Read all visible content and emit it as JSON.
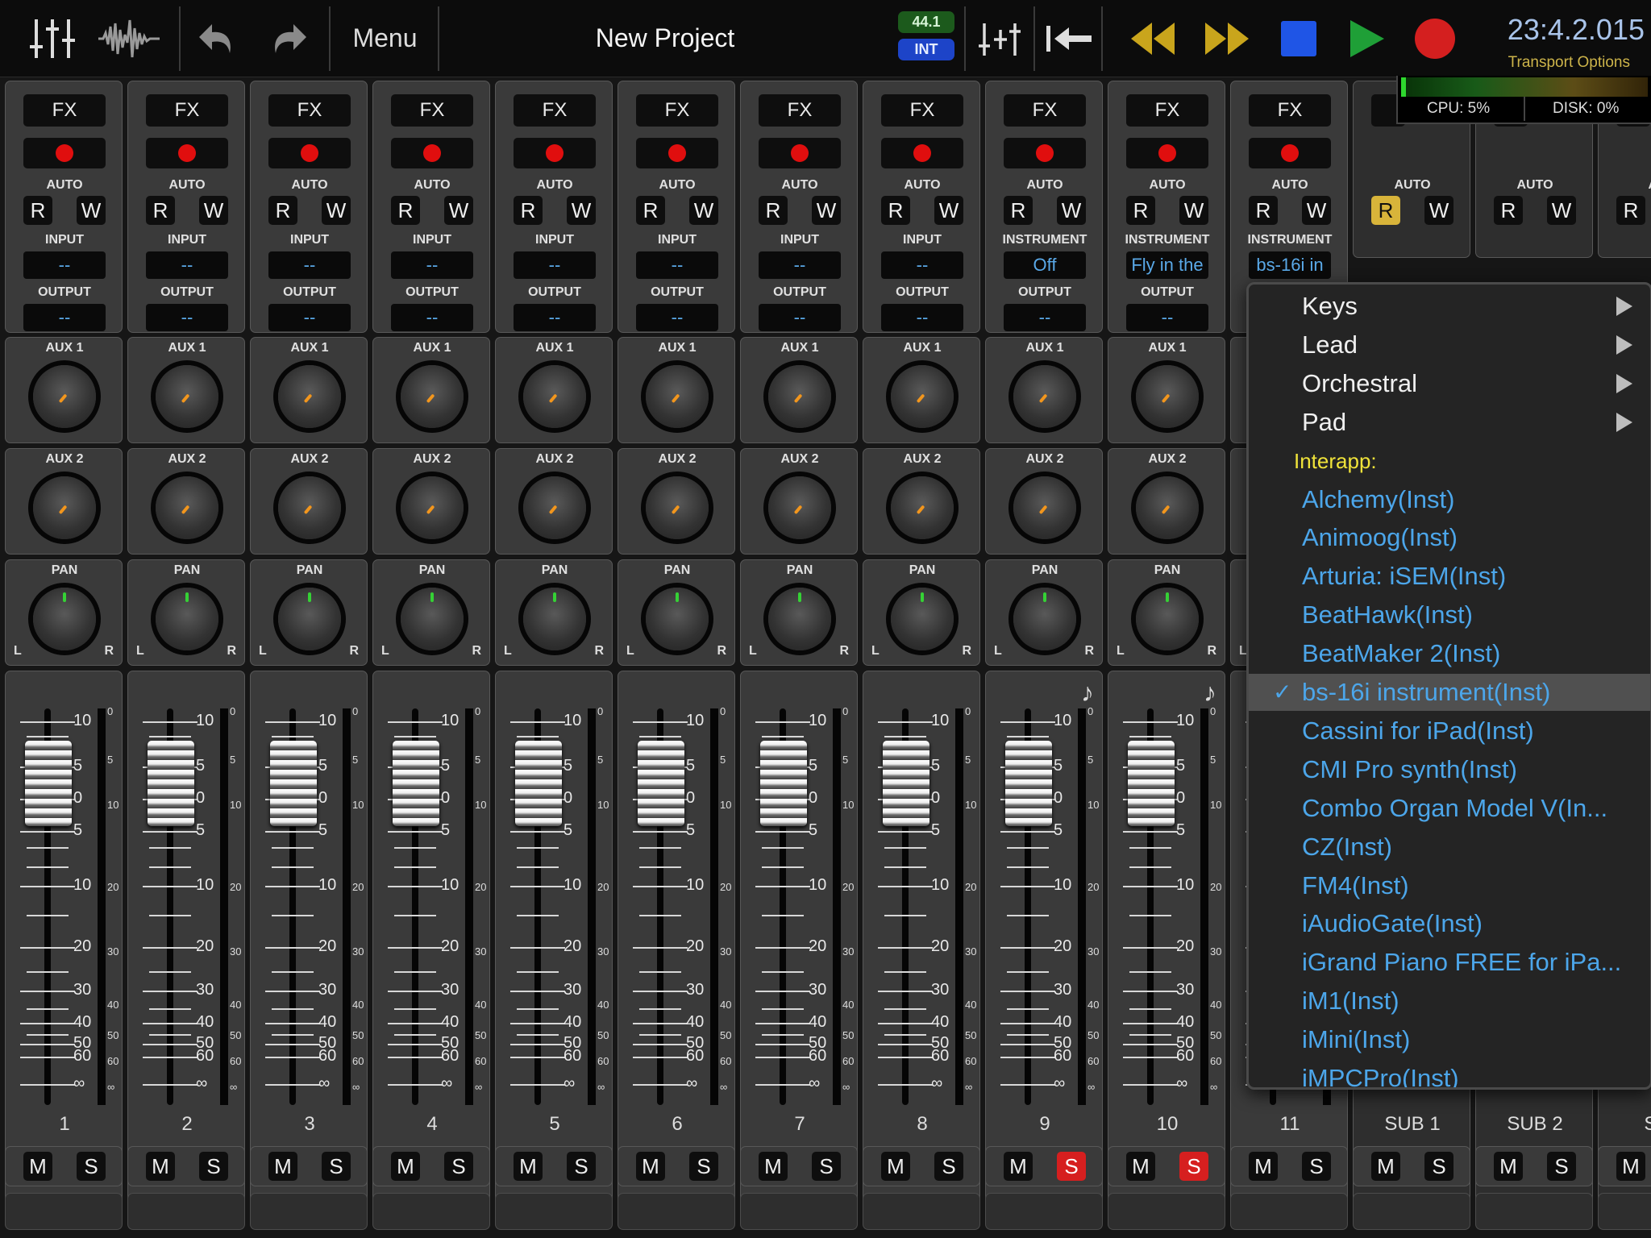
{
  "toolbar": {
    "menu_label": "Menu",
    "project_title": "New Project",
    "sample_rate": "44.1",
    "sync_source": "INT",
    "time": "23:4.2.015",
    "transport_options": "Transport Options",
    "icons": [
      "mixer-sliders-icon",
      "waveform-icon",
      "undo-icon",
      "redo-icon",
      "add-track-icon",
      "return-to-start-icon",
      "rewind-icon",
      "fast-forward-icon",
      "stop-icon",
      "play-icon",
      "record-icon"
    ],
    "colors": {
      "rewind": "#c9a51c",
      "stop": "#1f55e6",
      "play": "#1f9f37",
      "record": "#d41f1f"
    }
  },
  "meters": {
    "cpu": "CPU:  5%",
    "disk": "DISK:  0%"
  },
  "labels": {
    "fx": "FX",
    "auto": "AUTO",
    "r": "R",
    "w": "W",
    "input": "INPUT",
    "instrument": "INSTRUMENT",
    "output": "OUTPUT",
    "aux1": "AUX 1",
    "aux2": "AUX 2",
    "pan": "PAN",
    "l": "L",
    "r_pan": "R",
    "m": "M",
    "s": "S"
  },
  "fader_scale": [
    "10",
    "5",
    "0",
    "5",
    "10",
    "20",
    "30",
    "40",
    "50",
    "60",
    "∞"
  ],
  "meter_scale": [
    "0",
    "5",
    "10",
    "20",
    "30",
    "40",
    "50",
    "60",
    "∞"
  ],
  "strips": [
    {
      "name": "1",
      "io_label": "INPUT",
      "input": "--",
      "output": "--",
      "solo_active": false,
      "midi": false
    },
    {
      "name": "2",
      "io_label": "INPUT",
      "input": "--",
      "output": "--",
      "solo_active": false,
      "midi": false
    },
    {
      "name": "3",
      "io_label": "INPUT",
      "input": "--",
      "output": "--",
      "solo_active": false,
      "midi": false
    },
    {
      "name": "4",
      "io_label": "INPUT",
      "input": "--",
      "output": "--",
      "solo_active": false,
      "midi": false
    },
    {
      "name": "5",
      "io_label": "INPUT",
      "input": "--",
      "output": "--",
      "solo_active": false,
      "midi": false
    },
    {
      "name": "6",
      "io_label": "INPUT",
      "input": "--",
      "output": "--",
      "solo_active": false,
      "midi": false
    },
    {
      "name": "7",
      "io_label": "INPUT",
      "input": "--",
      "output": "--",
      "solo_active": false,
      "midi": false
    },
    {
      "name": "8",
      "io_label": "INPUT",
      "input": "--",
      "output": "--",
      "solo_active": false,
      "midi": false
    },
    {
      "name": "9",
      "io_label": "INSTRUMENT",
      "input": "Off",
      "output": "--",
      "solo_active": true,
      "midi": true
    },
    {
      "name": "10",
      "io_label": "INSTRUMENT",
      "input": "Fly in the",
      "output": "--",
      "solo_active": true,
      "midi": true
    },
    {
      "name": "11",
      "io_label": "INSTRUMENT",
      "input": "bs-16i in",
      "output": "",
      "solo_active": false,
      "midi": false
    }
  ],
  "subs": [
    {
      "name": "SUB 1",
      "r_active": true
    },
    {
      "name": "SUB 2",
      "r_active": false
    },
    {
      "name": "SU",
      "r_active": false,
      "auto": "AU"
    }
  ],
  "popup": {
    "items": [
      {
        "type": "cat",
        "label": "Keys"
      },
      {
        "type": "cat",
        "label": "Lead"
      },
      {
        "type": "cat",
        "label": "Orchestral"
      },
      {
        "type": "cat",
        "label": "Pad"
      },
      {
        "type": "hdr",
        "label": "Interapp:"
      },
      {
        "type": "inst",
        "label": "Alchemy(Inst)"
      },
      {
        "type": "inst",
        "label": "Animoog(Inst)"
      },
      {
        "type": "inst",
        "label": "Arturia: iSEM(Inst)"
      },
      {
        "type": "inst",
        "label": "BeatHawk(Inst)"
      },
      {
        "type": "inst",
        "label": "BeatMaker 2(Inst)"
      },
      {
        "type": "inst",
        "label": "bs-16i instrument(Inst)",
        "selected": true,
        "check": "✓"
      },
      {
        "type": "inst",
        "label": "Cassini for iPad(Inst)"
      },
      {
        "type": "inst",
        "label": "CMI Pro synth(Inst)"
      },
      {
        "type": "inst",
        "label": "Combo Organ Model V(In..."
      },
      {
        "type": "inst",
        "label": "CZ(Inst)"
      },
      {
        "type": "inst",
        "label": "FM4(Inst)"
      },
      {
        "type": "inst",
        "label": "iAudioGate(Inst)"
      },
      {
        "type": "inst",
        "label": "iGrand Piano FREE for iPa..."
      },
      {
        "type": "inst",
        "label": "iM1(Inst)"
      },
      {
        "type": "inst",
        "label": "iMini(Inst)"
      },
      {
        "type": "inst",
        "label": "iMPCPro(Inst)"
      }
    ]
  }
}
